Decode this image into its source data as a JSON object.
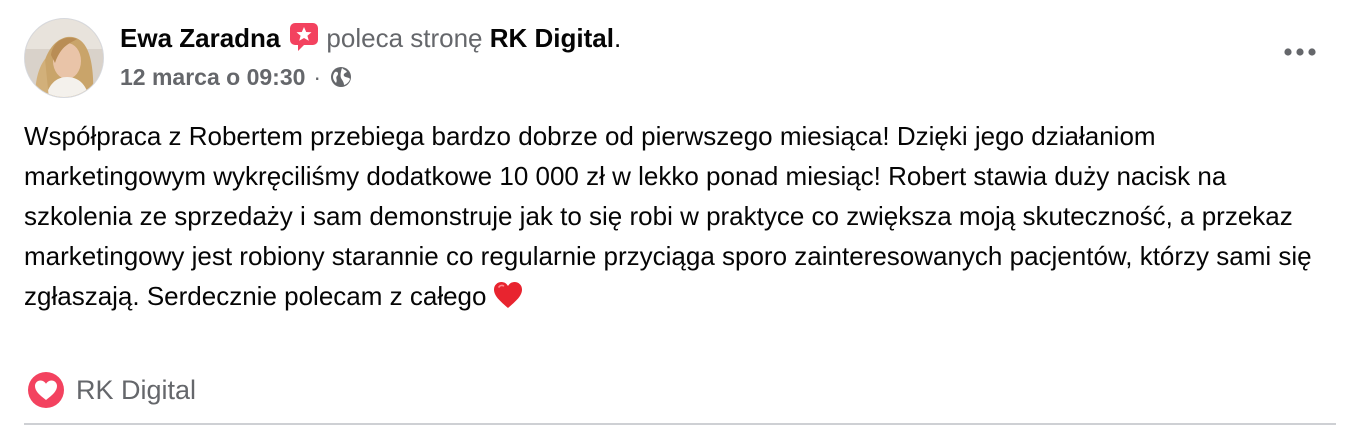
{
  "post": {
    "author_name": "Ewa Zaradna",
    "recommend_icon": "recommendation-star-badge-icon",
    "recommend_text": "poleca stronę",
    "page_name": "RK Digital",
    "period": ".",
    "timestamp": "12 marca o 09:30",
    "separator": "·",
    "privacy_icon": "globe-icon",
    "more_icon": "more-options-icon",
    "body_text": "Współpraca z Robertem przebiega bardzo dobrze od pierwszego miesiąca! Dzięki jego działaniom marketingowym wykręciliśmy dodatkowe 10 000 zł w lekko ponad miesiąc! Robert stawia duży nacisk na szkolenia ze sprzedaży i sam demonstruje jak to się robi w praktyce co zwiększa moją skuteczność, a przekaz marketingowy jest robiony starannie co regularnie przyciąga sporo zainteresowanych pacjentów, którzy sami się zgłaszają. Serdecznie polecam z całego",
    "body_emoji": "heart-emoji",
    "tagged_page": {
      "icon": "recommend-heart-icon",
      "label": "RK Digital"
    }
  },
  "colors": {
    "primary_text": "#050505",
    "secondary_text": "#65676b",
    "badge_pink": "#f3425f",
    "divider": "#ced0d4"
  }
}
